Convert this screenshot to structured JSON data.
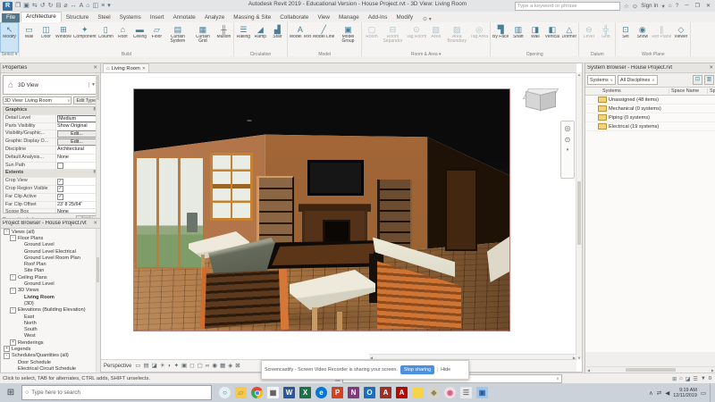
{
  "colors": {
    "accent_blue": "#cde4f5",
    "file_tab": "#54788a",
    "crop_border": "#bb7f7f",
    "stop_button": "#4a90e2"
  },
  "titlebar": {
    "title": "Autodesk Revit 2019 - Educational Version - House Project.rvt - 3D View: Living Room",
    "search_placeholder": "Type a keyword or phrase",
    "sign_in": "Sign In",
    "qat_icons": [
      {
        "name": "revit-logo",
        "glyph": "R",
        "logo": true
      },
      {
        "name": "open-icon",
        "glyph": "❐"
      },
      {
        "name": "save-icon",
        "glyph": "▣"
      },
      {
        "name": "sync-icon",
        "glyph": "⇆"
      },
      {
        "name": "undo-icon",
        "glyph": "↺"
      },
      {
        "name": "redo-icon",
        "glyph": "↻"
      },
      {
        "name": "print-icon",
        "glyph": "⊟"
      },
      {
        "name": "measure-icon",
        "glyph": "⌀"
      },
      {
        "name": "aligned-dimension-icon",
        "glyph": "↔"
      },
      {
        "name": "text-icon",
        "glyph": "A"
      },
      {
        "name": "default-3d-view-icon",
        "glyph": "⌂"
      },
      {
        "name": "section-icon",
        "glyph": "◫"
      },
      {
        "name": "thin-lines-icon",
        "glyph": "≡"
      },
      {
        "name": "qat-dropdown-icon",
        "glyph": "▾"
      }
    ],
    "right_icons": [
      {
        "name": "star-icon",
        "glyph": "☆"
      },
      {
        "name": "account-icon",
        "glyph": "⊙"
      }
    ],
    "menu_icons": [
      {
        "name": "signin-dropdown-icon",
        "glyph": "▾"
      },
      {
        "name": "app-store-icon",
        "glyph": "⌂"
      },
      {
        "name": "help-icon",
        "glyph": "?"
      }
    ],
    "window_buttons": [
      {
        "name": "minimize-button",
        "glyph": "─"
      },
      {
        "name": "maximize-button",
        "glyph": "❐"
      },
      {
        "name": "close-button",
        "glyph": "✕"
      }
    ]
  },
  "ribbon": {
    "tabs": [
      {
        "label": "File",
        "name": "tab-file",
        "file": true
      },
      {
        "label": "Architecture",
        "name": "tab-architecture",
        "active": true
      },
      {
        "label": "Structure",
        "name": "tab-structure"
      },
      {
        "label": "Steel",
        "name": "tab-steel"
      },
      {
        "label": "Systems",
        "name": "tab-systems"
      },
      {
        "label": "Insert",
        "name": "tab-insert"
      },
      {
        "label": "Annotate",
        "name": "tab-ann otate"
      },
      {
        "label": "Analyze",
        "name": "tab-analyze"
      },
      {
        "label": "Massing & Site",
        "name": "tab-massing-site"
      },
      {
        "label": "Collaborate",
        "name": "tab-collaborate"
      },
      {
        "label": "View",
        "name": "tab-view"
      },
      {
        "label": "Manage",
        "name": "tab-manage"
      },
      {
        "label": "Add-Ins",
        "name": "tab-add-ins"
      },
      {
        "label": "Modify",
        "name": "tab-modify"
      }
    ],
    "groups": [
      {
        "label": "Select ▾",
        "name": "ribbon-group-select",
        "buttons": [
          {
            "label": "Modify",
            "glyph": "↖",
            "name": "modify-button",
            "active": true
          }
        ]
      },
      {
        "label": "Build",
        "name": "ribbon-group-build",
        "buttons": [
          {
            "label": "Wall",
            "glyph": "▭",
            "name": "wall-button"
          },
          {
            "label": "Door",
            "glyph": "◫",
            "name": "door-button"
          },
          {
            "label": "Window",
            "glyph": "⊞",
            "name": "window-button"
          },
          {
            "label": "Component",
            "glyph": "✦",
            "name": "component-button"
          },
          {
            "label": "Column",
            "glyph": "▯",
            "name": "column-button"
          },
          {
            "label": "Roof",
            "glyph": "⌂",
            "name": "roof-button"
          },
          {
            "label": "Ceiling",
            "glyph": "▬",
            "name": "ceiling-button"
          },
          {
            "label": "Floor",
            "glyph": "▱",
            "name": "floor-button"
          },
          {
            "label": "Curtain System",
            "glyph": "▤",
            "name": "curtain-system-button"
          },
          {
            "label": "Curtain Grid",
            "glyph": "▦",
            "name": "curtain-grid-button"
          },
          {
            "label": "Mullion",
            "glyph": "╫",
            "name": "mullion-button"
          }
        ]
      },
      {
        "label": "Circulation",
        "name": "ribbon-group-circulation",
        "buttons": [
          {
            "label": "Railing",
            "glyph": "☰",
            "name": "railing-button"
          },
          {
            "label": "Ramp",
            "glyph": "◢",
            "name": "ramp-button"
          },
          {
            "label": "Stair",
            "glyph": "▟",
            "name": "stair-button"
          }
        ]
      },
      {
        "label": "Model",
        "name": "ribbon-group-model",
        "buttons": [
          {
            "label": "Model Text",
            "glyph": "A",
            "name": "model-text-button"
          },
          {
            "label": "Model Line",
            "glyph": "╱",
            "name": "model-line-button"
          },
          {
            "label": "Model Group",
            "glyph": "▣",
            "name": "model-group-button"
          }
        ]
      },
      {
        "label": "Room & Area ▾",
        "name": "ribbon-group-room-area",
        "buttons": [
          {
            "label": "Room",
            "glyph": "▢",
            "name": "room-button",
            "disabled": true
          },
          {
            "label": "Room Separator",
            "glyph": "⊟",
            "name": "room-separator-button",
            "disabled": true
          },
          {
            "label": "Tag Room",
            "glyph": "⊙",
            "name": "tag-room-button",
            "disabled": true
          },
          {
            "label": "Area",
            "glyph": "▧",
            "name": "area-button",
            "disabled": true
          },
          {
            "label": "Area Boundary",
            "glyph": "▨",
            "name": "area-boundary-button",
            "disabled": true
          },
          {
            "label": "Tag Area",
            "glyph": "◎",
            "name": "tag-area-button",
            "disabled": true
          }
        ]
      },
      {
        "label": "Opening",
        "name": "ribbon-group-opening",
        "buttons": [
          {
            "label": "By Face",
            "glyph": "▜",
            "name": "by-face-button"
          },
          {
            "label": "Shaft",
            "glyph": "▥",
            "name": "shaft-button"
          },
          {
            "label": "Wall",
            "glyph": "◨",
            "name": "wall-opening-button"
          },
          {
            "label": "Vertical",
            "glyph": "◧",
            "name": "vertical-opening-button"
          },
          {
            "label": "Dormer",
            "glyph": "△",
            "name": "dormer-button"
          }
        ]
      },
      {
        "label": "Datum",
        "name": "ribbon-group-datum",
        "buttons": [
          {
            "label": "Level",
            "glyph": "⊖",
            "name": "level-button",
            "disabled": true
          },
          {
            "label": "Grid",
            "glyph": "╬",
            "name": "grid-button",
            "disabled": true
          }
        ]
      },
      {
        "label": "Work Plane",
        "name": "ribbon-group-work-plane",
        "buttons": [
          {
            "label": "Set",
            "glyph": "⊡",
            "name": "set-work-plane-button"
          },
          {
            "label": "Show",
            "glyph": "◉",
            "name": "show-work-plane-button"
          },
          {
            "label": "Ref Plane",
            "glyph": "∥",
            "name": "ref-plane-button",
            "disabled": true
          },
          {
            "label": "Viewer",
            "glyph": "◇",
            "name": "viewer-button"
          }
        ]
      }
    ]
  },
  "view_tab": {
    "label": "Living Room"
  },
  "properties": {
    "title": "Properties",
    "type_selector": {
      "label": "3D View"
    },
    "view_selector": "3D View: Living Room",
    "edit_type": "Edit Type",
    "rows": [
      {
        "label": "Graphics",
        "type": "section",
        "value": "↟"
      },
      {
        "label": "Detail Level",
        "value": "Medium",
        "type": "input"
      },
      {
        "label": "Parts Visibility",
        "value": "Show Original",
        "type": "text"
      },
      {
        "label": "Visibility/Graphic...",
        "value": "Edit...",
        "type": "button"
      },
      {
        "label": "Graphic Display O...",
        "value": "Edit...",
        "type": "button"
      },
      {
        "label": "Discipline",
        "value": "Architectural",
        "type": "text"
      },
      {
        "label": "Default Analysis...",
        "value": "None",
        "type": "text"
      },
      {
        "label": "Sun Path",
        "type": "check"
      },
      {
        "label": "Extents",
        "type": "section",
        "value": "↟"
      },
      {
        "label": "Crop View",
        "type": "check",
        "checked": true
      },
      {
        "label": "Crop Region Visible",
        "type": "check",
        "checked": true
      },
      {
        "label": "Far Clip Active",
        "type": "check",
        "checked": true
      },
      {
        "label": "Far Clip Offset",
        "value": "23' 8 25/64\"",
        "type": "text"
      },
      {
        "label": "Scope Box",
        "value": "None",
        "type": "text"
      },
      {
        "label": "Section Box",
        "type": "check"
      }
    ],
    "help_link": "Properties help",
    "apply_button": "Apply"
  },
  "project_browser": {
    "title": "Project Browser - House Project.rvt",
    "tree": [
      {
        "label": "Views (all)",
        "level": 0,
        "exp": "-",
        "name": "tree-views-all"
      },
      {
        "label": "Floor Plans",
        "level": 1,
        "exp": "-",
        "name": "tree-floor-plans"
      },
      {
        "label": "Ground Level",
        "level": 2
      },
      {
        "label": "Ground Level Electrical",
        "level": 2
      },
      {
        "label": "Ground Level Room Plan",
        "level": 2
      },
      {
        "label": "Roof Plan",
        "level": 2
      },
      {
        "label": "Site Plan",
        "level": 2
      },
      {
        "label": "Ceiling Plans",
        "level": 1,
        "exp": "-",
        "name": "tree-ceiling-plans"
      },
      {
        "label": "Ground Level",
        "level": 2
      },
      {
        "label": "3D Views",
        "level": 1,
        "exp": "-",
        "name": "tree-3d-views"
      },
      {
        "label": "Living Room",
        "level": 2,
        "bold": true,
        "name": "tree-living-room"
      },
      {
        "label": "{3D}",
        "level": 2
      },
      {
        "label": "Elevations (Building Elevation)",
        "level": 1,
        "exp": "-",
        "name": "tree-elevations"
      },
      {
        "label": "East",
        "level": 2
      },
      {
        "label": "North",
        "level": 2
      },
      {
        "label": "South",
        "level": 2
      },
      {
        "label": "West",
        "level": 2
      },
      {
        "label": "Renderings",
        "level": 1,
        "exp": "+"
      },
      {
        "label": "Legends",
        "level": 0,
        "exp": "+"
      },
      {
        "label": "Schedules/Quantities (all)",
        "level": 0,
        "exp": "-",
        "name": "tree-schedules"
      },
      {
        "label": "Door Schedule",
        "level": 1
      },
      {
        "label": "Electrical Circuit Schedule",
        "level": 1
      }
    ]
  },
  "system_browser": {
    "title": "System Browser - House Project.rvt",
    "filters": [
      {
        "label": "Systems",
        "name": "systems-filter-dropdown"
      },
      {
        "label": "All Disciplines",
        "name": "disciplines-filter-dropdown"
      }
    ],
    "toolbar_icons": [
      {
        "name": "autofit-columns-icon",
        "glyph": "⊡"
      },
      {
        "name": "column-settings-icon",
        "glyph": "▥"
      }
    ],
    "columns": [
      "Systems",
      "Space Name",
      "Space Number"
    ],
    "rows": [
      {
        "label": "Unassigned (48 items)",
        "exp": "+",
        "name": "system-row-unassigned"
      },
      {
        "label": "Mechanical (0 systems)",
        "name": "system-row-mechanical"
      },
      {
        "label": "Piping (0 systems)",
        "name": "system-row-piping"
      },
      {
        "label": "Electrical (19 systems)",
        "exp": "+",
        "name": "system-row-electrical"
      }
    ]
  },
  "viewport": {
    "label": "Perspective",
    "controls": [
      {
        "name": "view-scale-icon",
        "glyph": "▭"
      },
      {
        "name": "detail-level-icon",
        "glyph": "▤"
      },
      {
        "name": "visual-style-icon",
        "glyph": "◪"
      },
      {
        "name": "sun-path-icon",
        "glyph": "☀"
      },
      {
        "name": "shadows-icon",
        "glyph": "◗"
      },
      {
        "name": "render-icon",
        "glyph": "✦"
      },
      {
        "name": "render-region-icon",
        "glyph": "▣"
      },
      {
        "name": "crop-view-icon",
        "glyph": "◻"
      },
      {
        "name": "crop-region-icon",
        "glyph": "▢"
      },
      {
        "name": "temporary-hide-icon",
        "glyph": "∞"
      },
      {
        "name": "reveal-hidden-icon",
        "glyph": "◉"
      },
      {
        "name": "temporary-view-properties-icon",
        "glyph": "▦"
      },
      {
        "name": "analytical-model-icon",
        "glyph": "◈"
      },
      {
        "name": "locked-view-icon",
        "glyph": "⊠"
      }
    ]
  },
  "notification": {
    "text": "Screencastify - Screen Video Recorder is sharing your screen.",
    "stop": "Stop sharing",
    "hide": "Hide"
  },
  "status_bar": {
    "hint": "Click to select, TAB for alternates, CTRL adds, SHIFT unselects.",
    "main_model": "Main Model",
    "right_icons": [
      {
        "name": "select-links-icon",
        "glyph": "⊞"
      },
      {
        "name": "select-underlay-icon",
        "glyph": "⌂"
      },
      {
        "name": "select-pinned-icon",
        "glyph": "◪"
      },
      {
        "name": "drag-select-icon",
        "glyph": "☰"
      },
      {
        "name": "filter-icon",
        "glyph": "▼"
      }
    ],
    "filter_count": "0"
  },
  "taskbar": {
    "search_placeholder": "Type here to search",
    "time": "9:19 AM",
    "date": "12/11/2019",
    "icons": [
      {
        "name": "cortana-icon",
        "glyph": "○",
        "bg": "#e8eef2",
        "fg": "#2b6a8a",
        "type": "round"
      },
      {
        "name": "file-explorer-icon",
        "glyph": "▱",
        "bg": "#f7c84e",
        "fg": "#c79a2a"
      },
      {
        "name": "chrome-icon",
        "glyph": "",
        "type": "chrome"
      },
      {
        "name": "calculator-icon",
        "glyph": "▦",
        "bg": "#f4f4f4",
        "fg": "#555555"
      },
      {
        "name": "word-icon",
        "glyph": "W",
        "bg": "#2b579a",
        "fg": "#ffffff"
      },
      {
        "name": "excel-icon",
        "glyph": "X",
        "bg": "#1e7145",
        "fg": "#ffffff"
      },
      {
        "name": "edge-icon",
        "glyph": "e",
        "bg": "#0078d7",
        "fg": "#ffffff",
        "type": "round"
      },
      {
        "name": "powerpoint-icon",
        "glyph": "P",
        "bg": "#d04423",
        "fg": "#ffffff"
      },
      {
        "name": "onenote-icon",
        "glyph": "N",
        "bg": "#80397b",
        "fg": "#ffffff"
      },
      {
        "name": "outlook-icon",
        "glyph": "O",
        "bg": "#1a6fba",
        "fg": "#ffffff"
      },
      {
        "name": "access-icon",
        "glyph": "A",
        "bg": "#9c3025",
        "fg": "#ffffff"
      },
      {
        "name": "acrobat-icon",
        "glyph": "A",
        "bg": "#b30b00",
        "fg": "#ffffff"
      },
      {
        "name": "sticky-notes-icon",
        "glyph": "",
        "bg": "#f5d44a",
        "fg": "#a8882a"
      },
      {
        "name": "viewer-3d-icon",
        "glyph": "◆",
        "bg": "#d8d2c2",
        "fg": "#8a8a5a"
      },
      {
        "name": "paint3d-icon",
        "glyph": "◉",
        "bg": "#f3dede",
        "fg": "#d4588a",
        "type": "round"
      },
      {
        "name": "settings-icon",
        "glyph": "☰",
        "bg": "#e8e8e8",
        "fg": "#777777"
      },
      {
        "name": "photos-icon",
        "glyph": "▣",
        "bg": "#9ec7f0",
        "fg": "#2a5a9a"
      }
    ],
    "tray_icons": [
      {
        "name": "tray-expand-icon",
        "glyph": "∧"
      },
      {
        "name": "network-icon",
        "glyph": "⇄"
      },
      {
        "name": "volume-icon",
        "glyph": "◀"
      }
    ],
    "action_center": {
      "name": "action-center-icon",
      "glyph": "▭"
    }
  }
}
